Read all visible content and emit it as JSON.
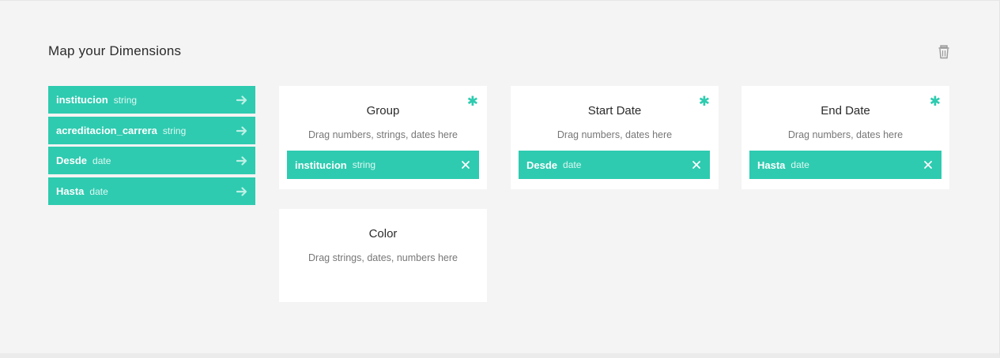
{
  "header": {
    "title": "Map your Dimensions",
    "delete_icon": "trash-icon"
  },
  "dimensions": [
    {
      "name": "institucion",
      "type": "string"
    },
    {
      "name": "acreditacion_carrera",
      "type": "string"
    },
    {
      "name": "Desde",
      "type": "date"
    },
    {
      "name": "Hasta",
      "type": "date"
    }
  ],
  "cards": {
    "group": {
      "title": "Group",
      "hint": "Drag numbers, strings, dates here",
      "required": "✱",
      "chip": {
        "name": "institucion",
        "type": "string"
      }
    },
    "start_date": {
      "title": "Start Date",
      "hint": "Drag numbers, dates here",
      "required": "✱",
      "chip": {
        "name": "Desde",
        "type": "date"
      }
    },
    "end_date": {
      "title": "End Date",
      "hint": "Drag numbers, dates here",
      "required": "✱",
      "chip": {
        "name": "Hasta",
        "type": "date"
      }
    },
    "color": {
      "title": "Color",
      "hint": "Drag strings, dates, numbers here"
    }
  },
  "colors": {
    "accent": "#2ecbb0",
    "background": "#f4f4f4",
    "card": "#ffffff"
  }
}
